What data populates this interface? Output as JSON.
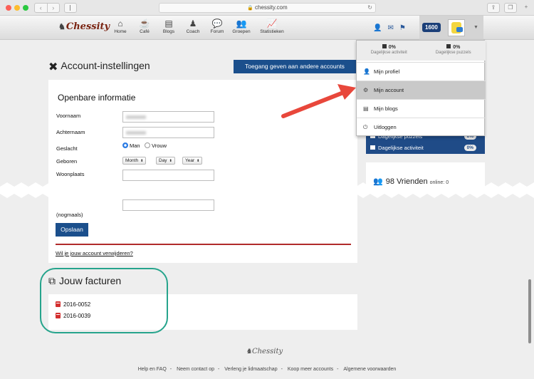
{
  "browser": {
    "url": "chessity.com"
  },
  "site": {
    "logo": "Chessity",
    "nav": [
      {
        "label": "Home",
        "icon": "home-icon"
      },
      {
        "label": "Café",
        "icon": "coffee-icon"
      },
      {
        "label": "Blogs",
        "icon": "blogs-icon"
      },
      {
        "label": "Coach",
        "icon": "coach-icon"
      },
      {
        "label": "Forum",
        "icon": "forum-icon"
      },
      {
        "label": "Groepen",
        "icon": "groups-icon"
      },
      {
        "label": "Statistieken",
        "icon": "stats-icon"
      }
    ],
    "rating": "1600"
  },
  "dropdown": {
    "stats": [
      {
        "value": "0%",
        "label": "Dagelijkse activiteit"
      },
      {
        "value": "0%",
        "label": "Dagelijkse puzzels"
      }
    ],
    "items": [
      {
        "label": "Mijn profiel",
        "icon": "user-icon"
      },
      {
        "label": "Mijn account",
        "icon": "gear-icon"
      },
      {
        "label": "Mijn blogs",
        "icon": "blogs-icon"
      },
      {
        "label": "Uitloggen",
        "icon": "power-icon"
      }
    ]
  },
  "page": {
    "title": "Account-instellingen",
    "grant_button": "Toegang geven aan andere accounts"
  },
  "form": {
    "section_title": "Openbare informatie",
    "voornaam_label": "Voornaam",
    "achternaam_label": "Achternaam",
    "geslacht_label": "Geslacht",
    "gender_man": "Man",
    "gender_vrouw": "Vrouw",
    "geboren_label": "Geboren",
    "month": "Month",
    "day": "Day",
    "year": "Year",
    "woonplaats_label": "Woonplaats",
    "repeat_label": "(nogmaals)",
    "save_button": "Opslaan",
    "delete_link": "Wil je jouw account verwijderen?"
  },
  "sidebar": {
    "puzzels_label": "Dagelijkse puzzels",
    "puzzels_pct": "0%",
    "activiteit_label": "Dagelijkse activiteit",
    "activiteit_pct": "0%",
    "friends_label": "98 Vrienden",
    "online_label": "online: 0"
  },
  "invoices": {
    "title": "Jouw facturen",
    "items": [
      "2016-0052",
      "2016-0039"
    ]
  },
  "footer": {
    "logo": "Chessity",
    "links": [
      "Help en FAQ",
      "Neem contact op",
      "Verleng je lidmaatschap",
      "Koop meer accounts",
      "Algemene voorwaarden"
    ]
  }
}
